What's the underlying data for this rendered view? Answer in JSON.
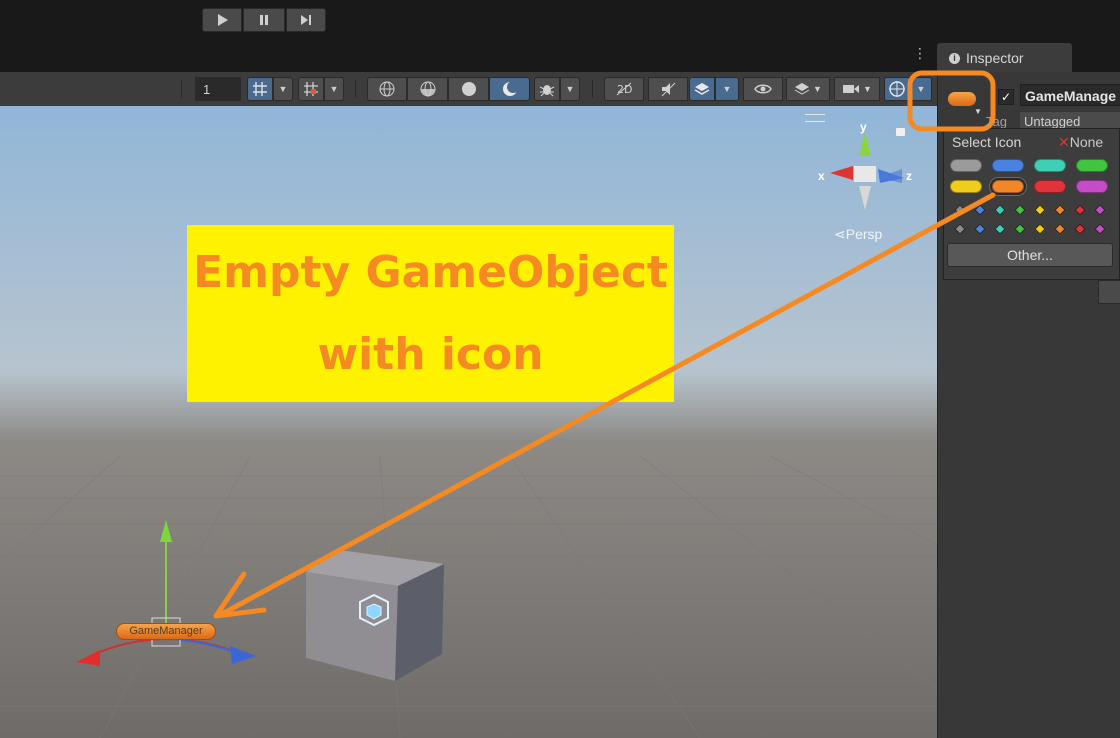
{
  "toolbar": {
    "grid_snap_value": "1"
  },
  "inspector": {
    "tab_label": "Inspector",
    "object_name": "GameManage",
    "tag_label": "Tag",
    "tag_value": "Untagged",
    "active": true
  },
  "icon_popup": {
    "title": "Select Icon",
    "none_label": "None",
    "other_button": "Other...",
    "label_icon_colors": [
      "#9b9b9b",
      "#4a82e0",
      "#3fcfb4",
      "#41c43f",
      "#f0cd1a",
      "#f4862a",
      "#e0343a",
      "#c64cc7"
    ],
    "small_icon_colors": [
      "#8a8a8a",
      "#4a82e0",
      "#3fcfb4",
      "#41c43f",
      "#f0cd1a",
      "#f4862a",
      "#e0343a",
      "#c64cc7"
    ],
    "selected_index": 5
  },
  "scene": {
    "projection_label": "Persp",
    "gizmo_axes": {
      "x": "x",
      "y": "y",
      "z": "z"
    },
    "object_label": "GameManager"
  },
  "annotation": {
    "line1": "Empty GameObject",
    "line2": "with icon",
    "color": "#f48a21",
    "background": "#fff200"
  }
}
